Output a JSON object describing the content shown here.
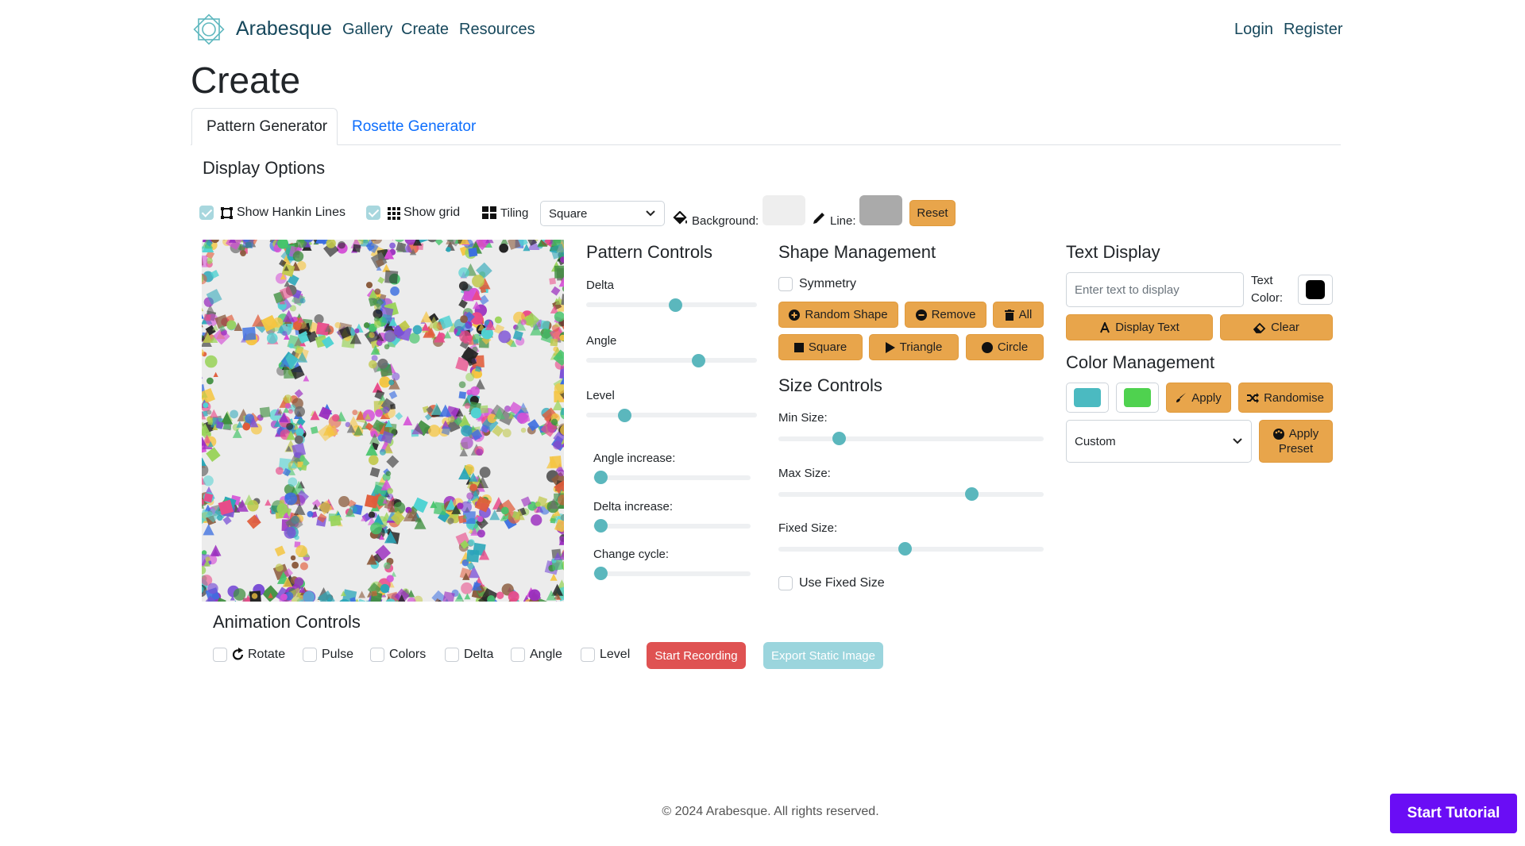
{
  "nav": {
    "brand": "Arabesque",
    "links": [
      "Gallery",
      "Create",
      "Resources"
    ],
    "login": "Login",
    "register": "Register"
  },
  "page_title": "Create",
  "tabs": [
    {
      "label": "Pattern Generator",
      "active": true
    },
    {
      "label": "Rosette Generator",
      "active": false
    }
  ],
  "display_options": {
    "title": "Display Options",
    "show_hankin_lines": {
      "label": "Show Hankin Lines",
      "checked": true,
      "icon": "hankin-square-icon"
    },
    "show_grid": {
      "label": "Show grid",
      "checked": true,
      "icon": "grid-icon"
    },
    "tiling": {
      "label": "Tiling",
      "icon": "tiling-icon",
      "value": "Square"
    },
    "background": {
      "label": "Background:",
      "color": "#eeeeee",
      "icon": "paint-bucket-icon"
    },
    "line": {
      "label": "Line:",
      "color": "#aaaaaa",
      "icon": "pencil-icon"
    },
    "reset": "Reset"
  },
  "pattern_controls": {
    "title": "Pattern Controls",
    "sliders": [
      {
        "label": "Delta",
        "value": 0.5
      },
      {
        "label": "Angle",
        "value": 0.65
      },
      {
        "label": "Level",
        "value": 0.22
      }
    ],
    "sub_sliders": [
      {
        "label": "Angle increase:",
        "value": 0.0
      },
      {
        "label": "Delta increase:",
        "value": 0.0
      },
      {
        "label": "Change cycle:",
        "value": 0.0
      }
    ]
  },
  "shape_management": {
    "title": "Shape Management",
    "symmetry": {
      "label": "Symmetry",
      "checked": false
    },
    "buttons": [
      "Random Shape",
      "Remove",
      "All",
      "Square",
      "Triangle",
      "Circle"
    ]
  },
  "size_controls": {
    "title": "Size Controls",
    "sliders": [
      {
        "label": "Min Size:",
        "value": 0.22
      },
      {
        "label": "Max Size:",
        "value": 0.72
      },
      {
        "label": "Fixed Size:",
        "value": 0.47
      }
    ],
    "use_fixed": {
      "label": "Use Fixed Size",
      "checked": false
    }
  },
  "text_display": {
    "title": "Text Display",
    "placeholder": "Enter text to display",
    "text_color_label_1": "Text",
    "text_color_label_2": "Color:",
    "text_color": "#000000",
    "display_text": "Display Text",
    "clear": "Clear"
  },
  "color_management": {
    "title": "Color Management",
    "color1": "#4bbac1",
    "color2": "#4fd24f",
    "apply": "Apply",
    "randomise": "Randomise",
    "preset_value": "Custom",
    "apply_preset_1": "Apply",
    "apply_preset_2": "Preset"
  },
  "animation_controls": {
    "title": "Animation Controls",
    "toggles": [
      {
        "label": "Rotate",
        "checked": false
      },
      {
        "label": "Pulse",
        "checked": false
      },
      {
        "label": "Colors",
        "checked": false
      },
      {
        "label": "Delta",
        "checked": false
      },
      {
        "label": "Angle",
        "checked": false
      },
      {
        "label": "Level",
        "checked": false
      }
    ],
    "start_recording": "Start Recording",
    "export_static": "Export Static Image"
  },
  "footer": "© 2024 Arabesque. All rights reserved.",
  "tutorial": "Start Tutorial",
  "colors": {
    "accent_orange": "#e8a54b",
    "accent_teal": "#5bb7bd",
    "link_blue": "#0d6efd",
    "nav_text": "#17485c",
    "record_red": "#df5252",
    "tutorial_purple": "#6a0df5"
  }
}
